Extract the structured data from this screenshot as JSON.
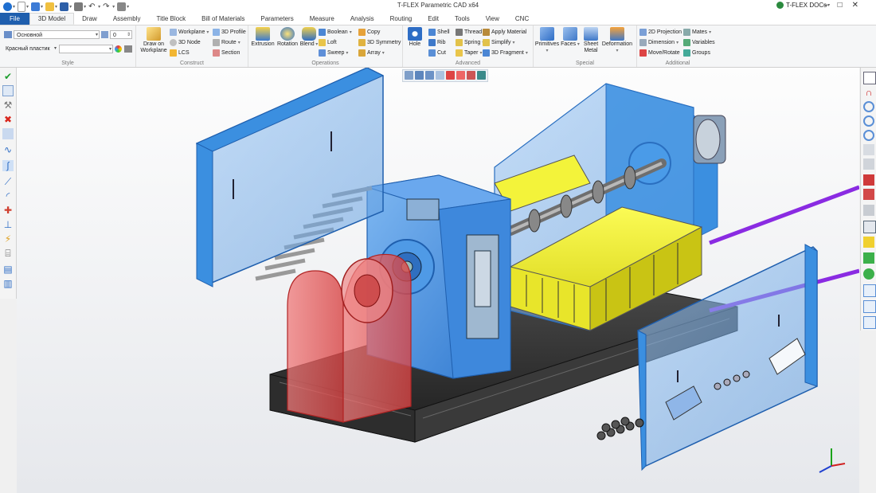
{
  "title_bar": {
    "app_title": "T-FLEX Parametric CAD x64",
    "docs_label": "T-FLEX DOCs",
    "window_controls": [
      "–",
      "□",
      "✕"
    ]
  },
  "tabs": [
    "File",
    "3D Model",
    "Draw",
    "Assembly",
    "Title Block",
    "Bill of Materials",
    "Parameters",
    "Measure",
    "Analysis",
    "Routing",
    "Edit",
    "Tools",
    "View",
    "CNC"
  ],
  "ribbon": {
    "style": {
      "label": "Style",
      "layer_value": "Основной",
      "level_value": "0",
      "material_value": "Красный пластик",
      "color_value": ""
    },
    "construct": {
      "label": "Construct",
      "draw_on_workplane": "Draw on\nWorkplane",
      "workplane": "Workplane",
      "node_3d": "3D Node",
      "lcs": "LCS",
      "profile_3d": "3D Profile",
      "route": "Route",
      "section": "Section"
    },
    "operations": {
      "label": "Operations",
      "extrusion": "Extrusion",
      "rotation": "Rotation",
      "blend": "Blend",
      "boolean": "Boolean",
      "loft": "Loft",
      "sweep": "Sweep",
      "copy": "Copy",
      "symmetry_3d": "3D Symmetry",
      "array": "Array"
    },
    "advanced": {
      "label": "Advanced",
      "hole": "Hole",
      "shell": "Shell",
      "rib": "Rib",
      "cut": "Cut",
      "thread": "Thread",
      "spring": "Spring",
      "taper": "Taper",
      "apply_material": "Apply Material",
      "simplify": "Simplify",
      "fragment_3d": "3D Fragment"
    },
    "special": {
      "label": "Special",
      "primitives": "Primitives",
      "faces": "Faces",
      "sheet_metal": "Sheet\nMetal",
      "deformation": "Deformation"
    },
    "additional": {
      "label": "Additional",
      "projection_2d": "2D Projection",
      "dimension": "Dimension",
      "move_rotate": "Move/Rotate",
      "mates": "Mates",
      "variables": "Variables",
      "groups": "Groups"
    }
  },
  "colors": {
    "file_tab": "#1f5fae",
    "part_blue": "#3b8fe0",
    "part_yellow": "#f1f122",
    "part_red": "#e85a5a",
    "frame_dark": "#2a2a2a",
    "shaft_purple": "#8a2be2"
  }
}
